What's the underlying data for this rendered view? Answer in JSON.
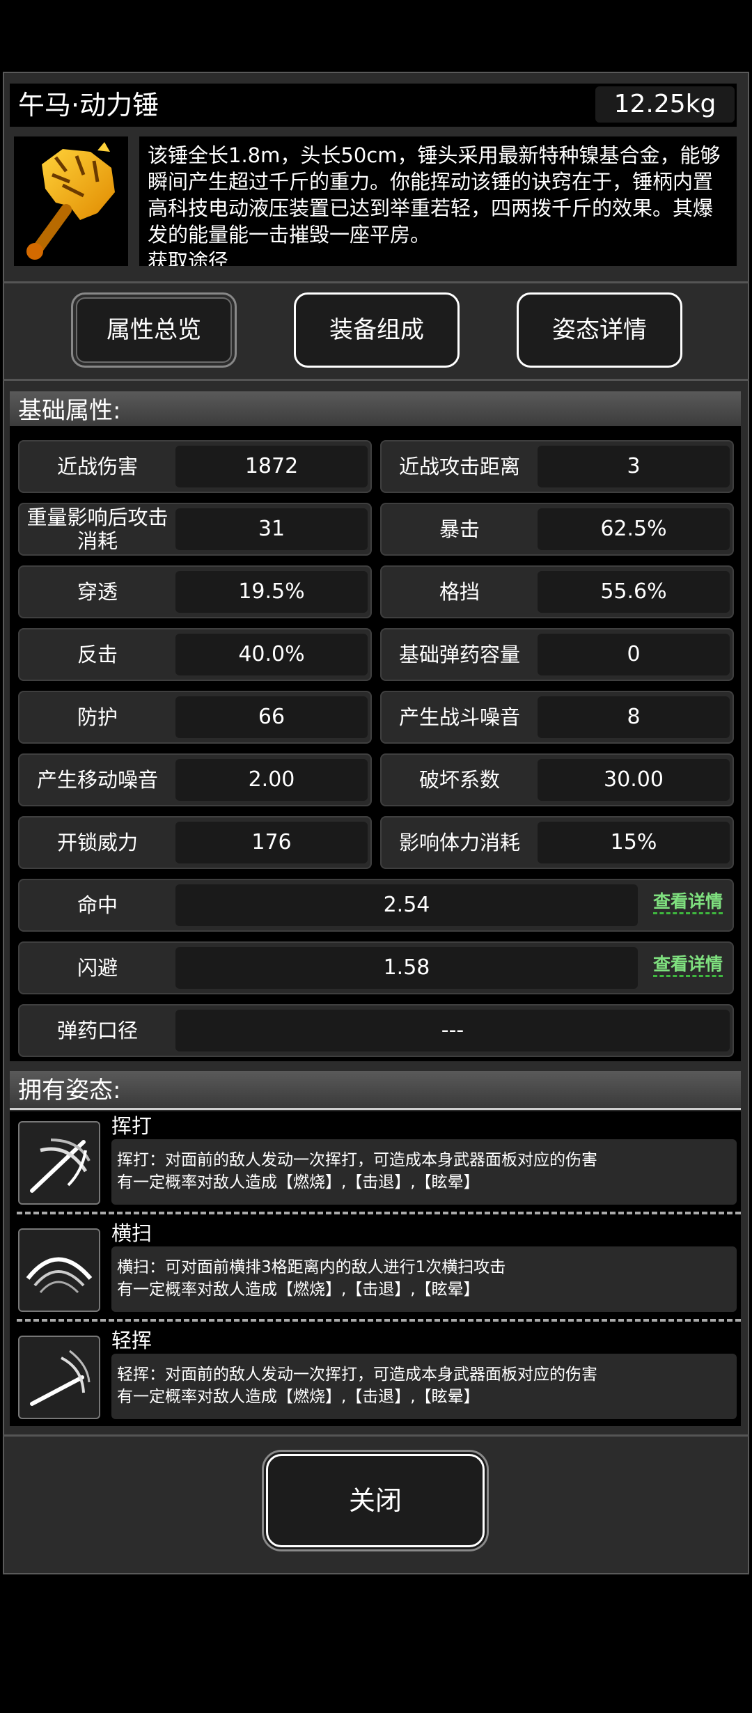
{
  "item": {
    "name": "午马·动力锤",
    "weight": "12.25kg",
    "icon": "golden-horse-hammer-icon",
    "description": "该锤全长1.8m，头长50cm，锤头采用最新特种镍基合金，能够瞬间产生超过千斤的重力。你能挥动该锤的诀窍在于，锤柄内置高科技电动液压装置已达到举重若轻，四两拨千斤的效果。其爆发的能量能一击摧毁一座平房。",
    "description_cut": "获取途径"
  },
  "tabs": [
    "属性总览",
    "装备组成",
    "姿态详情"
  ],
  "sections": {
    "basic": "基础属性:",
    "stances": "拥有姿态:"
  },
  "attributes": [
    {
      "label": "近战伤害",
      "value": "1872"
    },
    {
      "label": "近战攻击距离",
      "value": "3"
    },
    {
      "label": "重量影响后攻击消耗",
      "value": "31"
    },
    {
      "label": "暴击",
      "value": "62.5%"
    },
    {
      "label": "穿透",
      "value": "19.5%"
    },
    {
      "label": "格挡",
      "value": "55.6%"
    },
    {
      "label": "反击",
      "value": "40.0%"
    },
    {
      "label": "基础弹药容量",
      "value": "0"
    },
    {
      "label": "防护",
      "value": "66"
    },
    {
      "label": "产生战斗噪音",
      "value": "8"
    },
    {
      "label": "产生移动噪音",
      "value": "2.00"
    },
    {
      "label": "破坏系数",
      "value": "30.00"
    },
    {
      "label": "开锁威力",
      "value": "176"
    },
    {
      "label": "影响体力消耗",
      "value": "15%"
    }
  ],
  "wide_attributes": [
    {
      "label": "命中",
      "value": "2.54",
      "link": "查看详情"
    },
    {
      "label": "闪避",
      "value": "1.58",
      "link": "查看详情"
    },
    {
      "label": "弹药口径",
      "value": "---"
    }
  ],
  "stances": [
    {
      "name": "挥打",
      "icon": "swing-slash-icon",
      "desc1": "挥打：对面前的敌人发动一次挥打，可造成本身武器面板对应的伤害",
      "desc2": "有一定概率对敌人造成【燃烧】,【击退】,【眩晕】"
    },
    {
      "name": "横扫",
      "icon": "sweep-slash-icon",
      "desc1": "横扫：可对面前横排3格距离内的敌人进行1次横扫攻击",
      "desc2": "有一定概率对敌人造成【燃烧】,【击退】,【眩晕】"
    },
    {
      "name": "轻挥",
      "icon": "light-swing-icon",
      "desc1": "轻挥：对面前的敌人发动一次挥打，可造成本身武器面板对应的伤害",
      "desc2": "有一定概率对敌人造成【燃烧】,【击退】,【眩晕】"
    }
  ],
  "close_label": "关闭"
}
